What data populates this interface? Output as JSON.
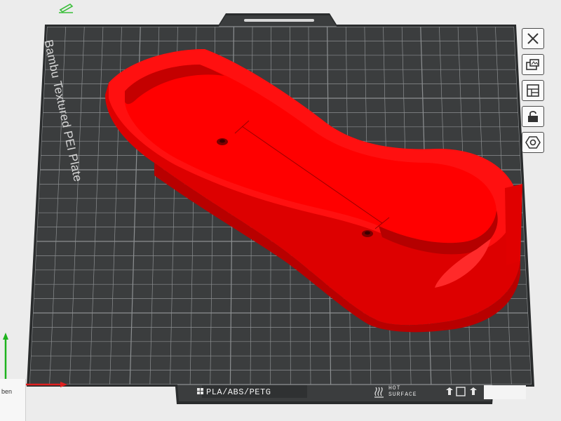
{
  "viewport": {
    "plate_name": "Bambu Textured PEI Plate",
    "material_tag": "PLA/ABS/PETG",
    "surface_line1": "HOT",
    "surface_line2": "SURFACE",
    "model_color": "#ff0000",
    "plate_color": "#3b3d3e",
    "grid_color": "#8c8f91"
  },
  "toolbar": {
    "buttons": [
      {
        "name": "close-button",
        "icon": "close-icon"
      },
      {
        "name": "arrange-button",
        "icon": "arrange-icon"
      },
      {
        "name": "layout-button",
        "icon": "layout-icon"
      },
      {
        "name": "lock-button",
        "icon": "lock-icon"
      },
      {
        "name": "settings-button",
        "icon": "hex-nut-icon"
      }
    ]
  },
  "panel": {
    "side_text": "ben"
  }
}
